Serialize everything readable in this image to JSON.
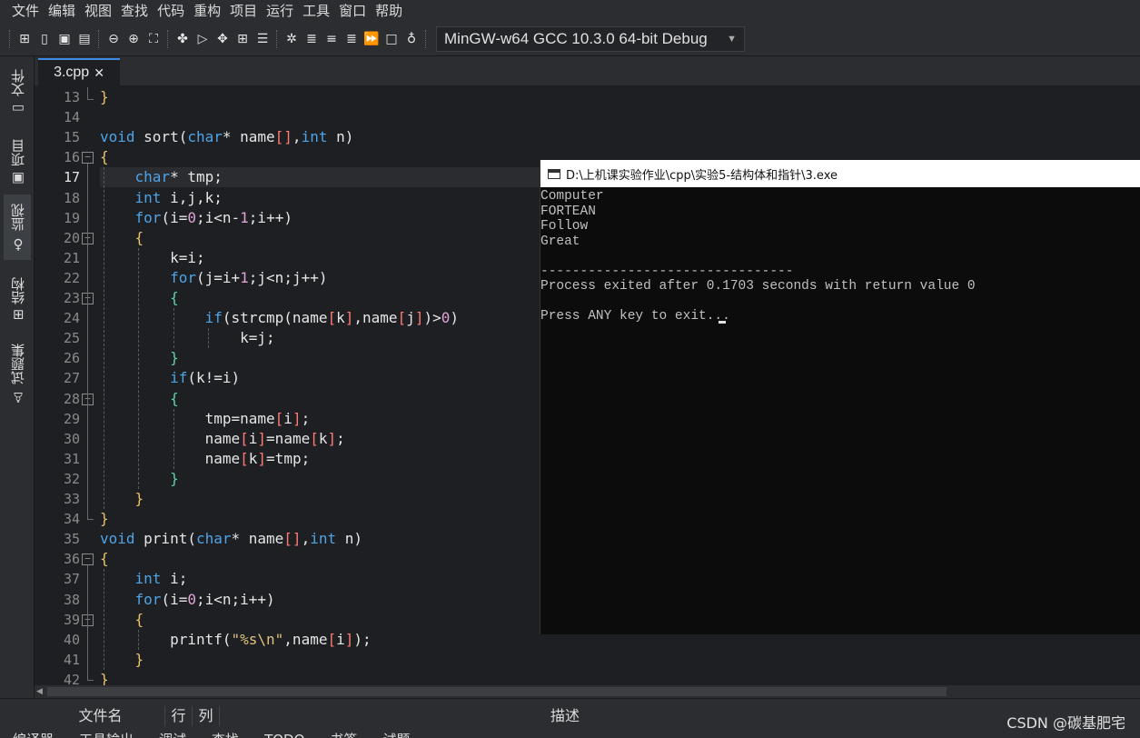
{
  "menu": [
    "文件",
    "编辑",
    "视图",
    "查找",
    "代码",
    "重构",
    "项目",
    "运行",
    "工具",
    "窗口",
    "帮助"
  ],
  "toolbar": {
    "compiler": "MinGW-w64 GCC 10.3.0 64-bit Debug"
  },
  "sidebar": {
    "tabs": [
      {
        "label": "文件",
        "icon": "folder-icon"
      },
      {
        "label": "项目",
        "icon": "project-icon"
      },
      {
        "label": "监视",
        "icon": "watch-icon"
      },
      {
        "label": "结构",
        "icon": "structure-icon"
      },
      {
        "label": "试题集",
        "icon": "problem-set-icon"
      }
    ]
  },
  "editor": {
    "tab_title": "3.cpp",
    "tab_close": "✕",
    "current_line": 17,
    "lines": [
      {
        "n": 13,
        "html": "<span class=\"br-y\">}</span>"
      },
      {
        "n": 14,
        "html": ""
      },
      {
        "n": 15,
        "html": "<span class=\"kw\">void</span> sort(<span class=\"kw\">char</span>* name<span class=\"br-r\">[]</span>,<span class=\"kw\">int</span> n)"
      },
      {
        "n": 16,
        "html": "<span class=\"br-y\">{</span>"
      },
      {
        "n": 17,
        "html": "    <span class=\"kw\">char</span>* tmp;"
      },
      {
        "n": 18,
        "html": "    <span class=\"kw\">int</span> i,j,k;"
      },
      {
        "n": 19,
        "html": "    <span class=\"kw\">for</span>(i=<span class=\"num\">0</span>;i&lt;n-<span class=\"num\">1</span>;i++)"
      },
      {
        "n": 20,
        "html": "    <span class=\"br-y\">{</span>"
      },
      {
        "n": 21,
        "html": "        k=i;"
      },
      {
        "n": 22,
        "html": "        <span class=\"kw\">for</span>(j=i+<span class=\"num\">1</span>;j&lt;n;j++)"
      },
      {
        "n": 23,
        "html": "        <span class=\"br-g\">{</span>"
      },
      {
        "n": 24,
        "html": "            <span class=\"kw\">if</span>(strcmp(name<span class=\"br-r\">[</span>k<span class=\"br-r\">]</span>,name<span class=\"br-r\">[</span>j<span class=\"br-r\">]</span>)&gt;<span class=\"num\">0</span>)"
      },
      {
        "n": 25,
        "html": "                k=j;"
      },
      {
        "n": 26,
        "html": "        <span class=\"br-g\">}</span>"
      },
      {
        "n": 27,
        "html": "        <span class=\"kw\">if</span>(k!=i)"
      },
      {
        "n": 28,
        "html": "        <span class=\"br-g\">{</span>"
      },
      {
        "n": 29,
        "html": "            tmp=name<span class=\"br-r\">[</span>i<span class=\"br-r\">]</span>;"
      },
      {
        "n": 30,
        "html": "            name<span class=\"br-r\">[</span>i<span class=\"br-r\">]</span>=name<span class=\"br-r\">[</span>k<span class=\"br-r\">]</span>;"
      },
      {
        "n": 31,
        "html": "            name<span class=\"br-r\">[</span>k<span class=\"br-r\">]</span>=tmp;"
      },
      {
        "n": 32,
        "html": "        <span class=\"br-g\">}</span>"
      },
      {
        "n": 33,
        "html": "    <span class=\"br-y\">}</span>"
      },
      {
        "n": 34,
        "html": "<span class=\"br-y\">}</span>"
      },
      {
        "n": 35,
        "html": "<span class=\"kw\">void</span> print(<span class=\"kw\">char</span>* name<span class=\"br-r\">[]</span>,<span class=\"kw\">int</span> n)"
      },
      {
        "n": 36,
        "html": "<span class=\"br-y\">{</span>"
      },
      {
        "n": 37,
        "html": "    <span class=\"kw\">int</span> i;"
      },
      {
        "n": 38,
        "html": "    <span class=\"kw\">for</span>(i=<span class=\"num\">0</span>;i&lt;n;i++)"
      },
      {
        "n": 39,
        "html": "    <span class=\"br-y\">{</span>"
      },
      {
        "n": 40,
        "html": "        printf(<span class=\"str\">\"%s\\n\"</span>,name<span class=\"br-r\">[</span>i<span class=\"br-r\">]</span>);"
      },
      {
        "n": 41,
        "html": "    <span class=\"br-y\">}</span>"
      },
      {
        "n": 42,
        "html": "<span class=\"br-y\">}</span>"
      }
    ]
  },
  "console": {
    "title": "D:\\上机课实验作业\\cpp\\实验5-结构体和指针\\3.exe",
    "lines": [
      "Computer",
      "FORTEAN",
      "Follow",
      "Great",
      "",
      "--------------------------------",
      "Process exited after 0.1703 seconds with return value 0",
      "",
      "Press ANY key to exit..."
    ]
  },
  "bottom": {
    "columns": [
      "文件名",
      "行",
      "列",
      "描述"
    ],
    "tabs": [
      "编译器",
      "工具输出",
      "调试",
      "查找",
      "TODO",
      "书签",
      "试题"
    ]
  },
  "watermark": "CSDN @碳基肥宅"
}
